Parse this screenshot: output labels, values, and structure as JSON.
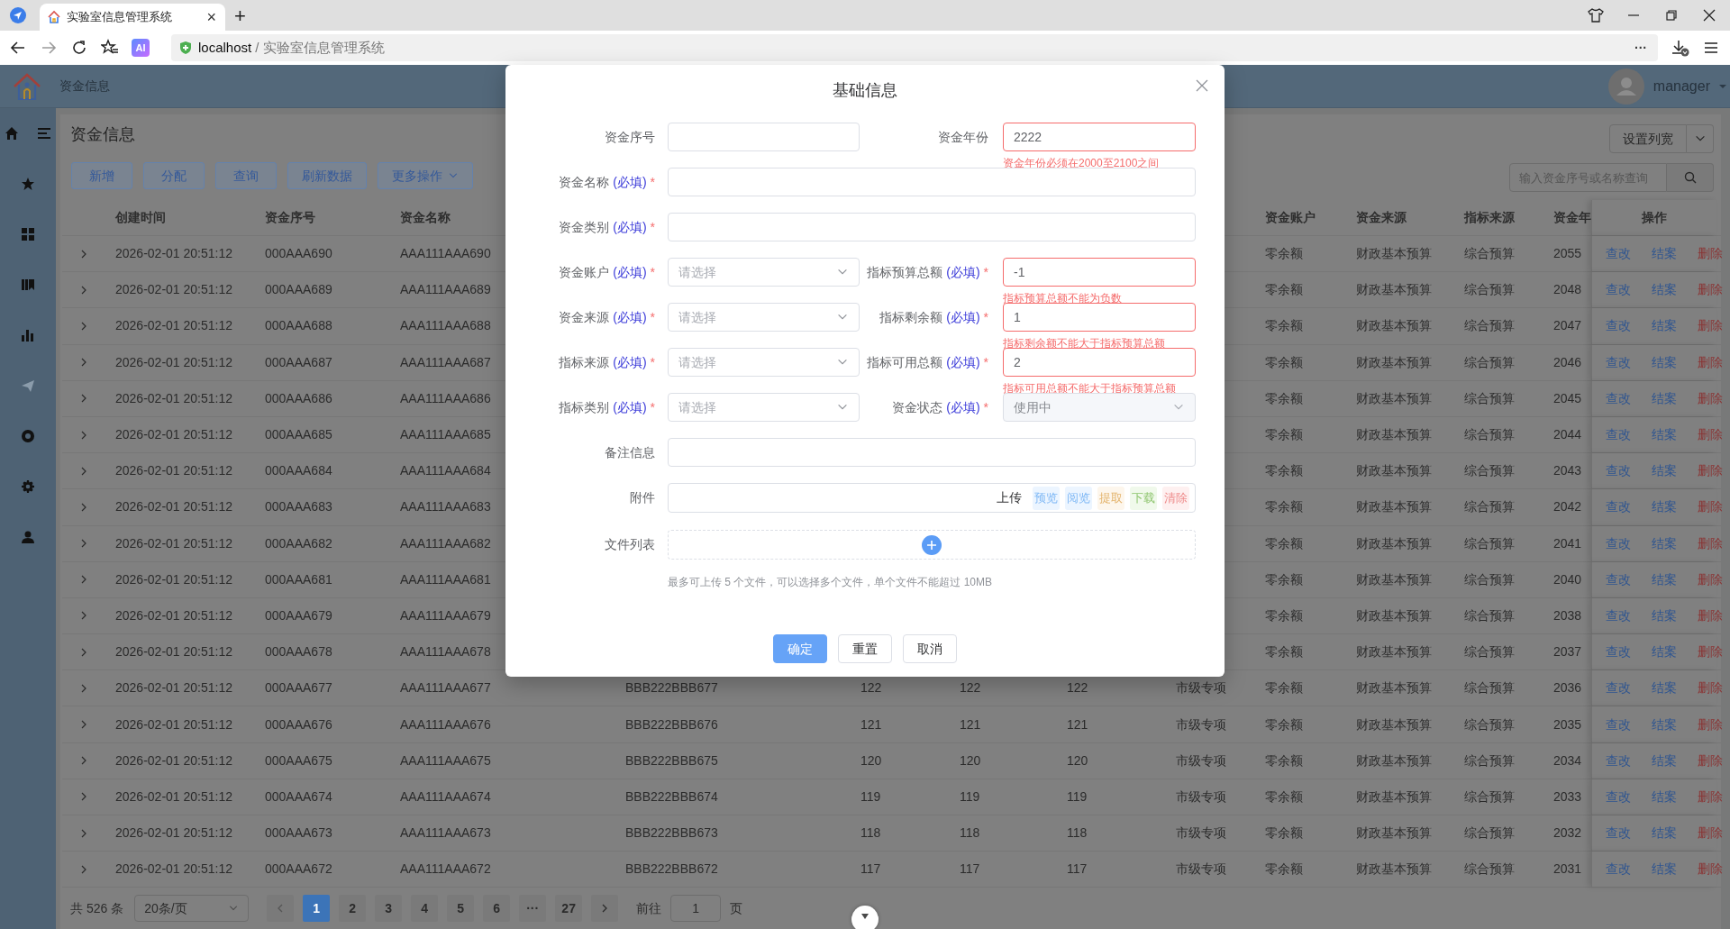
{
  "browser": {
    "tab_title": "实验室信息管理系统",
    "tab_close": "×",
    "new_tab": "+",
    "ai_badge": "AI",
    "url_host": "localhost",
    "url_path": "/ 实验室信息管理系统",
    "more": "···"
  },
  "app": {
    "breadcrumb": "资金信息",
    "user": "manager"
  },
  "sidebar": {
    "items": [
      {
        "selected": false
      },
      {
        "selected": false
      },
      {
        "selected": false
      },
      {
        "selected": false
      },
      {
        "selected": true
      },
      {
        "selected": false
      },
      {
        "selected": false
      },
      {
        "selected": false
      }
    ]
  },
  "page": {
    "title": "资金信息",
    "toolbar": [
      "新增",
      "分配",
      "查询",
      "刷新数据",
      "更多操作"
    ],
    "set_width": "设置列宽",
    "search_placeholder": "输入资金序号或名称查询"
  },
  "table": {
    "columns": {
      "created": "创建时间",
      "serial": "资金序号",
      "name": "资金名称",
      "account": "资金账户",
      "source": "资金来源",
      "index_source": "指标来源",
      "year": "资金年",
      "actions": "操作"
    },
    "rows": [
      {
        "created": "2026-02-01 20:51:12",
        "serial": "000AAA690",
        "name": "AAA111AAA690",
        "account": "零余额",
        "source": "财政基本预算",
        "index_source": "综合预算",
        "year": "2055",
        "actions": [
          {
            "label": "查改",
            "kind": "link"
          },
          {
            "label": "结案",
            "kind": "link"
          },
          {
            "label": "删除",
            "kind": "danger"
          }
        ]
      },
      {
        "created": "2026-02-01 20:51:12",
        "serial": "000AAA689",
        "name": "AAA111AAA689",
        "account": "零余额",
        "source": "财政基本预算",
        "index_source": "综合预算",
        "year": "2048",
        "actions": [
          {
            "label": "查改",
            "kind": "link"
          },
          {
            "label": "结案",
            "kind": "link"
          },
          {
            "label": "删除",
            "kind": "danger"
          }
        ]
      },
      {
        "created": "2026-02-01 20:51:12",
        "serial": "000AAA688",
        "name": "AAA111AAA688",
        "account": "零余额",
        "source": "财政基本预算",
        "index_source": "综合预算",
        "year": "2047",
        "actions": [
          {
            "label": "查改",
            "kind": "link"
          },
          {
            "label": "结案",
            "kind": "link"
          },
          {
            "label": "删除",
            "kind": "danger"
          }
        ]
      },
      {
        "created": "2026-02-01 20:51:12",
        "serial": "000AAA687",
        "name": "AAA111AAA687",
        "account": "零余额",
        "source": "财政基本预算",
        "index_source": "综合预算",
        "year": "2046",
        "actions": [
          {
            "label": "查改",
            "kind": "link"
          },
          {
            "label": "结案",
            "kind": "link"
          },
          {
            "label": "删除",
            "kind": "danger"
          }
        ]
      },
      {
        "created": "2026-02-01 20:51:12",
        "serial": "000AAA686",
        "name": "AAA111AAA686",
        "account": "零余额",
        "source": "财政基本预算",
        "index_source": "综合预算",
        "year": "2045",
        "actions": [
          {
            "label": "查改",
            "kind": "link"
          },
          {
            "label": "结案",
            "kind": "link"
          },
          {
            "label": "删除",
            "kind": "danger"
          }
        ]
      },
      {
        "created": "2026-02-01 20:51:12",
        "serial": "000AAA685",
        "name": "AAA111AAA685",
        "account": "零余额",
        "source": "财政基本预算",
        "index_source": "综合预算",
        "year": "2044",
        "actions": [
          {
            "label": "查改",
            "kind": "link"
          },
          {
            "label": "结案",
            "kind": "link"
          },
          {
            "label": "删除",
            "kind": "danger"
          }
        ]
      },
      {
        "created": "2026-02-01 20:51:12",
        "serial": "000AAA684",
        "name": "AAA111AAA684",
        "account": "零余额",
        "source": "财政基本预算",
        "index_source": "综合预算",
        "year": "2043",
        "actions": [
          {
            "label": "查改",
            "kind": "link"
          },
          {
            "label": "结案",
            "kind": "link"
          },
          {
            "label": "删除",
            "kind": "danger"
          }
        ]
      },
      {
        "created": "2026-02-01 20:51:12",
        "serial": "000AAA683",
        "name": "AAA111AAA683",
        "account": "零余额",
        "source": "财政基本预算",
        "index_source": "综合预算",
        "year": "2042",
        "actions": [
          {
            "label": "查改",
            "kind": "link"
          },
          {
            "label": "结案",
            "kind": "link"
          },
          {
            "label": "删除",
            "kind": "danger"
          }
        ]
      },
      {
        "created": "2026-02-01 20:51:12",
        "serial": "000AAA682",
        "name": "AAA111AAA682",
        "account": "零余额",
        "source": "财政基本预算",
        "index_source": "综合预算",
        "year": "2041",
        "actions": [
          {
            "label": "查改",
            "kind": "link"
          },
          {
            "label": "结案",
            "kind": "link"
          },
          {
            "label": "删除",
            "kind": "danger"
          }
        ]
      },
      {
        "created": "2026-02-01 20:51:12",
        "serial": "000AAA681",
        "name": "AAA111AAA681",
        "account": "零余额",
        "source": "财政基本预算",
        "index_source": "综合预算",
        "year": "2040",
        "actions": [
          {
            "label": "查改",
            "kind": "link"
          },
          {
            "label": "结案",
            "kind": "link"
          },
          {
            "label": "删除",
            "kind": "danger"
          }
        ]
      },
      {
        "created": "2026-02-01 20:51:12",
        "serial": "000AAA679",
        "name": "AAA111AAA679",
        "account": "零余额",
        "source": "财政基本预算",
        "index_source": "综合预算",
        "year": "2038",
        "actions": [
          {
            "label": "查改",
            "kind": "link"
          },
          {
            "label": "结案",
            "kind": "link"
          },
          {
            "label": "删除",
            "kind": "danger"
          }
        ]
      },
      {
        "created": "2026-02-01 20:51:12",
        "serial": "000AAA678",
        "name": "AAA111AAA678",
        "account": "零余额",
        "source": "财政基本预算",
        "index_source": "综合预算",
        "year": "2037",
        "actions": [
          {
            "label": "查改",
            "kind": "link"
          },
          {
            "label": "结案",
            "kind": "link"
          },
          {
            "label": "删除",
            "kind": "danger"
          }
        ]
      },
      {
        "created": "2026-02-01 20:51:12",
        "serial": "000AAA677",
        "name": "AAA111AAA677",
        "column_4": "BBB222BBB677",
        "column_5": "122",
        "column_6": "122",
        "column_7": "122",
        "column_8": "市级专项",
        "account": "零余额",
        "source": "财政基本预算",
        "index_source": "综合预算",
        "year": "2036",
        "actions": [
          {
            "label": "查改",
            "kind": "link"
          },
          {
            "label": "结案",
            "kind": "link"
          },
          {
            "label": "删除",
            "kind": "danger"
          }
        ]
      },
      {
        "created": "2026-02-01 20:51:12",
        "serial": "000AAA676",
        "name": "AAA111AAA676",
        "column_4": "BBB222BBB676",
        "column_5": "121",
        "column_6": "121",
        "column_7": "121",
        "column_8": "市级专项",
        "account": "零余额",
        "source": "财政基本预算",
        "index_source": "综合预算",
        "year": "2035",
        "actions": [
          {
            "label": "查改",
            "kind": "link"
          },
          {
            "label": "结案",
            "kind": "link"
          },
          {
            "label": "删除",
            "kind": "danger"
          }
        ]
      },
      {
        "created": "2026-02-01 20:51:12",
        "serial": "000AAA675",
        "name": "AAA111AAA675",
        "column_4": "BBB222BBB675",
        "column_5": "120",
        "column_6": "120",
        "column_7": "120",
        "column_8": "市级专项",
        "account": "零余额",
        "source": "财政基本预算",
        "index_source": "综合预算",
        "year": "2034",
        "actions": [
          {
            "label": "查改",
            "kind": "link"
          },
          {
            "label": "结案",
            "kind": "link"
          },
          {
            "label": "删除",
            "kind": "danger"
          }
        ]
      },
      {
        "created": "2026-02-01 20:51:12",
        "serial": "000AAA674",
        "name": "AAA111AAA674",
        "column_4": "BBB222BBB674",
        "column_5": "119",
        "column_6": "119",
        "column_7": "119",
        "column_8": "市级专项",
        "account": "零余额",
        "source": "财政基本预算",
        "index_source": "综合预算",
        "year": "2033",
        "actions": [
          {
            "label": "查改",
            "kind": "link"
          },
          {
            "label": "结案",
            "kind": "link"
          },
          {
            "label": "删除",
            "kind": "danger"
          }
        ]
      },
      {
        "created": "2026-02-01 20:51:12",
        "serial": "000AAA673",
        "name": "AAA111AAA673",
        "column_4": "BBB222BBB673",
        "column_5": "118",
        "column_6": "118",
        "column_7": "118",
        "column_8": "市级专项",
        "account": "零余额",
        "source": "财政基本预算",
        "index_source": "综合预算",
        "year": "2032",
        "actions": [
          {
            "label": "查改",
            "kind": "link"
          },
          {
            "label": "结案",
            "kind": "link"
          },
          {
            "label": "删除",
            "kind": "danger"
          }
        ]
      },
      {
        "created": "2026-02-01 20:51:12",
        "serial": "000AAA672",
        "name": "AAA111AAA672",
        "column_4": "BBB222BBB672",
        "column_5": "117",
        "column_6": "117",
        "column_7": "117",
        "column_8": "市级专项",
        "account": "零余额",
        "source": "财政基本预算",
        "index_source": "综合预算",
        "year": "2031",
        "actions": [
          {
            "label": "查改",
            "kind": "link"
          },
          {
            "label": "结案",
            "kind": "link"
          },
          {
            "label": "删除",
            "kind": "danger"
          }
        ]
      }
    ]
  },
  "pagination": {
    "total": "共 526 条",
    "page_size": "20条/页",
    "pages": [
      {
        "label": "1",
        "selected": true
      },
      {
        "label": "2",
        "selected": false
      },
      {
        "label": "3",
        "selected": false
      },
      {
        "label": "4",
        "selected": false
      },
      {
        "label": "5",
        "selected": false
      },
      {
        "label": "6",
        "selected": false
      },
      {
        "label": "···",
        "selected": false
      },
      {
        "label": "27",
        "selected": false
      }
    ],
    "goto": "前往",
    "goto_value": "1",
    "unit": "页"
  },
  "modal": {
    "title": "基础信息",
    "rows": [
      [
        {
          "label": "资金序号",
          "kind": "input"
        },
        {
          "label": "资金年份",
          "kind": "input",
          "value": "2222",
          "error": "资金年份必须在2000至2100之间"
        }
      ],
      [
        {
          "label": "资金名称",
          "note": "(必填)",
          "mark": "*",
          "kind": "input"
        }
      ],
      [
        {
          "label": "资金类别",
          "note": "(必填)",
          "mark": "*",
          "kind": "input"
        }
      ],
      [
        {
          "label": "资金账户",
          "note": "(必填)",
          "mark": "*",
          "kind": "select",
          "placeholder": "请选择",
          "disabled": false
        },
        {
          "label": "指标预算总额",
          "note": "(必填)",
          "mark": "*",
          "kind": "input",
          "value": "-1",
          "error": "指标预算总额不能为负数"
        }
      ],
      [
        {
          "label": "资金来源",
          "note": "(必填)",
          "mark": "*",
          "kind": "select",
          "placeholder": "请选择",
          "disabled": false
        },
        {
          "label": "指标剩余额",
          "note": "(必填)",
          "mark": "*",
          "kind": "input",
          "value": "1",
          "error": "指标剩余额不能大于指标预算总额"
        }
      ],
      [
        {
          "label": "指标来源",
          "note": "(必填)",
          "mark": "*",
          "kind": "select",
          "placeholder": "请选择",
          "disabled": false
        },
        {
          "label": "指标可用总额",
          "note": "(必填)",
          "mark": "*",
          "kind": "input",
          "value": "2",
          "error": "指标可用总额不能大于指标预算总额"
        }
      ],
      [
        {
          "label": "指标类别",
          "note": "(必填)",
          "mark": "*",
          "kind": "select",
          "placeholder": "请选择",
          "disabled": false
        },
        {
          "label": "资金状态",
          "note": "(必填)",
          "mark": "*",
          "kind": "select",
          "value": "使用中",
          "disabled": true
        }
      ],
      [
        {
          "label": "备注信息",
          "kind": "input"
        }
      ]
    ],
    "attachment": {
      "label": "附件",
      "actions": [
        {
          "label": "上传",
          "kind": "text",
          "disabled": false
        },
        {
          "label": "预览",
          "kind": "primary",
          "disabled": true
        },
        {
          "label": "阅览",
          "kind": "primary",
          "disabled": true
        },
        {
          "label": "提取",
          "kind": "warning",
          "disabled": true
        },
        {
          "label": "下载",
          "kind": "success",
          "disabled": true
        },
        {
          "label": "清除",
          "kind": "danger",
          "disabled": true
        }
      ]
    },
    "file_list": {
      "label": "文件列表"
    },
    "hint": "最多可上传 5 个文件，可以选择多个文件，单个文件不能超过 10MB",
    "buttons": [
      {
        "label": "确定",
        "kind": "primary"
      },
      {
        "label": "重置",
        "kind": "default"
      },
      {
        "label": "取消",
        "kind": "default"
      }
    ]
  }
}
